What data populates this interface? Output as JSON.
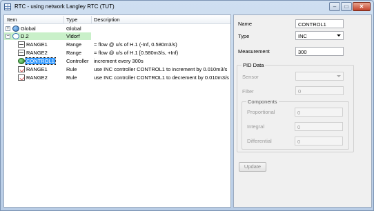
{
  "window": {
    "title": "RTC - using network Langley RTC (TUT)",
    "buttons": {
      "minimize": "–",
      "maximize": "□",
      "close": "✕"
    }
  },
  "tree": {
    "headers": {
      "item": "Item",
      "type": "Type",
      "description": "Description"
    },
    "rows": [
      {
        "expander": "+",
        "name": "Global",
        "type": "Global",
        "description": "",
        "icon": "globe-icon"
      },
      {
        "expander": "−",
        "name": "D.2",
        "type": "Vldorf",
        "description": "",
        "icon": "vldorf-icon"
      },
      {
        "name": "RANGE1",
        "type": "Range",
        "description": "= flow @ u/s of H.1 (-Inf, 0.580m3/s)",
        "icon": "range-icon"
      },
      {
        "name": "RANGE2",
        "type": "Range",
        "description": "= flow @ u/s of H.1 [0.580m3/s, +Inf)",
        "icon": "range-icon"
      },
      {
        "name": "CONTROL1",
        "type": "Controller",
        "description": "increment every 300s",
        "icon": "controller-icon"
      },
      {
        "name": "RANGE1",
        "type": "Rule",
        "description": "use INC controller CONTROL1 to increment by 0.010m3/s",
        "icon": "rule-icon"
      },
      {
        "name": "RANGE2",
        "type": "Rule",
        "description": "use INC controller CONTROL1 to decrement by 0.010m3/s",
        "icon": "rule-icon"
      }
    ]
  },
  "detail": {
    "name_label": "Name",
    "name_value": "CONTROL1",
    "type_label": "Type",
    "type_value": "INC",
    "measurement_label": "Measurement",
    "measurement_value": "300",
    "pid_group": "PID Data",
    "sensor_label": "Sensor",
    "sensor_value": "",
    "filter_label": "Filter",
    "filter_value": "0",
    "components_group": "Components",
    "proportional_label": "Proportional",
    "proportional_value": "0",
    "integral_label": "Integral",
    "integral_value": "0",
    "differential_label": "Differential",
    "differential_value": "0",
    "update_button": "Update"
  },
  "colors": {
    "selection": "#3399ff",
    "highlight": "#c9f0c9",
    "window": "#c7d8ec"
  }
}
